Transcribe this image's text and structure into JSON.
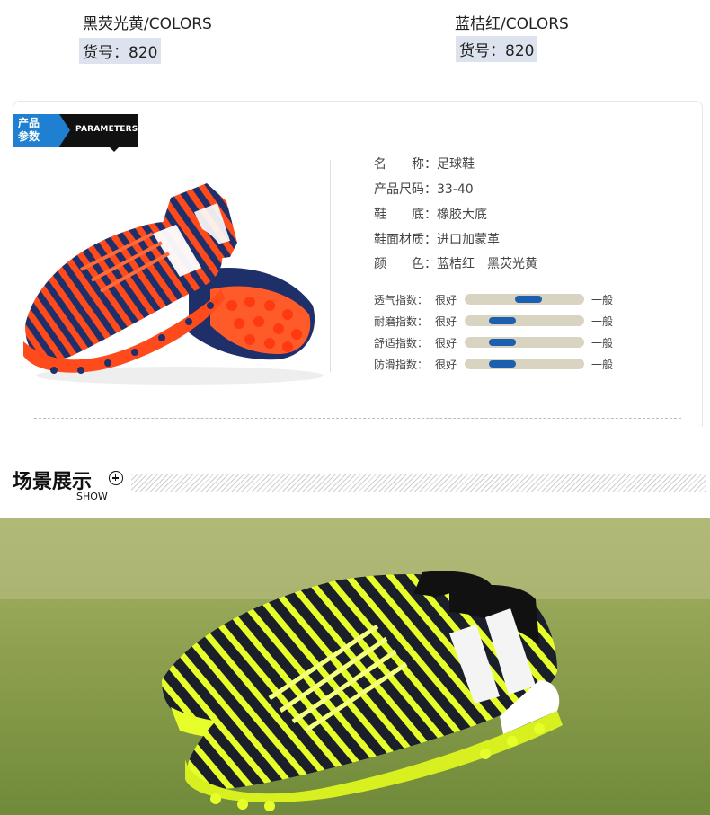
{
  "variants": [
    {
      "name": "黑荧光黄/COLORS",
      "sku": "货号：820"
    },
    {
      "name": "蓝桔红/COLORS",
      "sku": "货号：820"
    }
  ],
  "params_tag": {
    "cn_line1": "产品",
    "cn_line2": "参数",
    "en": "PARAMETERS"
  },
  "specs": [
    {
      "label": "名　　称：",
      "value": "足球鞋"
    },
    {
      "label": "产品尺码：",
      "value": "33-40"
    },
    {
      "label": "鞋　　底：",
      "value": "橡胶大底"
    },
    {
      "label": "鞋面材质：",
      "value": "进口加蒙革"
    },
    {
      "label": "颜　　色：",
      "value": "蓝桔红　黑荧光黄"
    }
  ],
  "ratings": [
    {
      "label": "透气指数：",
      "good": "很好",
      "ok": "一般",
      "level": 0.55
    },
    {
      "label": "耐磨指数：",
      "good": "很好",
      "ok": "一般",
      "level": 0.2
    },
    {
      "label": "舒适指数：",
      "good": "很好",
      "ok": "一般",
      "level": 0.2
    },
    {
      "label": "防滑指数：",
      "good": "很好",
      "ok": "一般",
      "level": 0.2
    }
  ],
  "scene": {
    "title": "场景展示",
    "subtitle": "SHOW"
  },
  "colors": {
    "accent_blue": "#1f7fd0",
    "rating_fill": "#1b5fae",
    "rating_track": "#d9d4c2"
  }
}
